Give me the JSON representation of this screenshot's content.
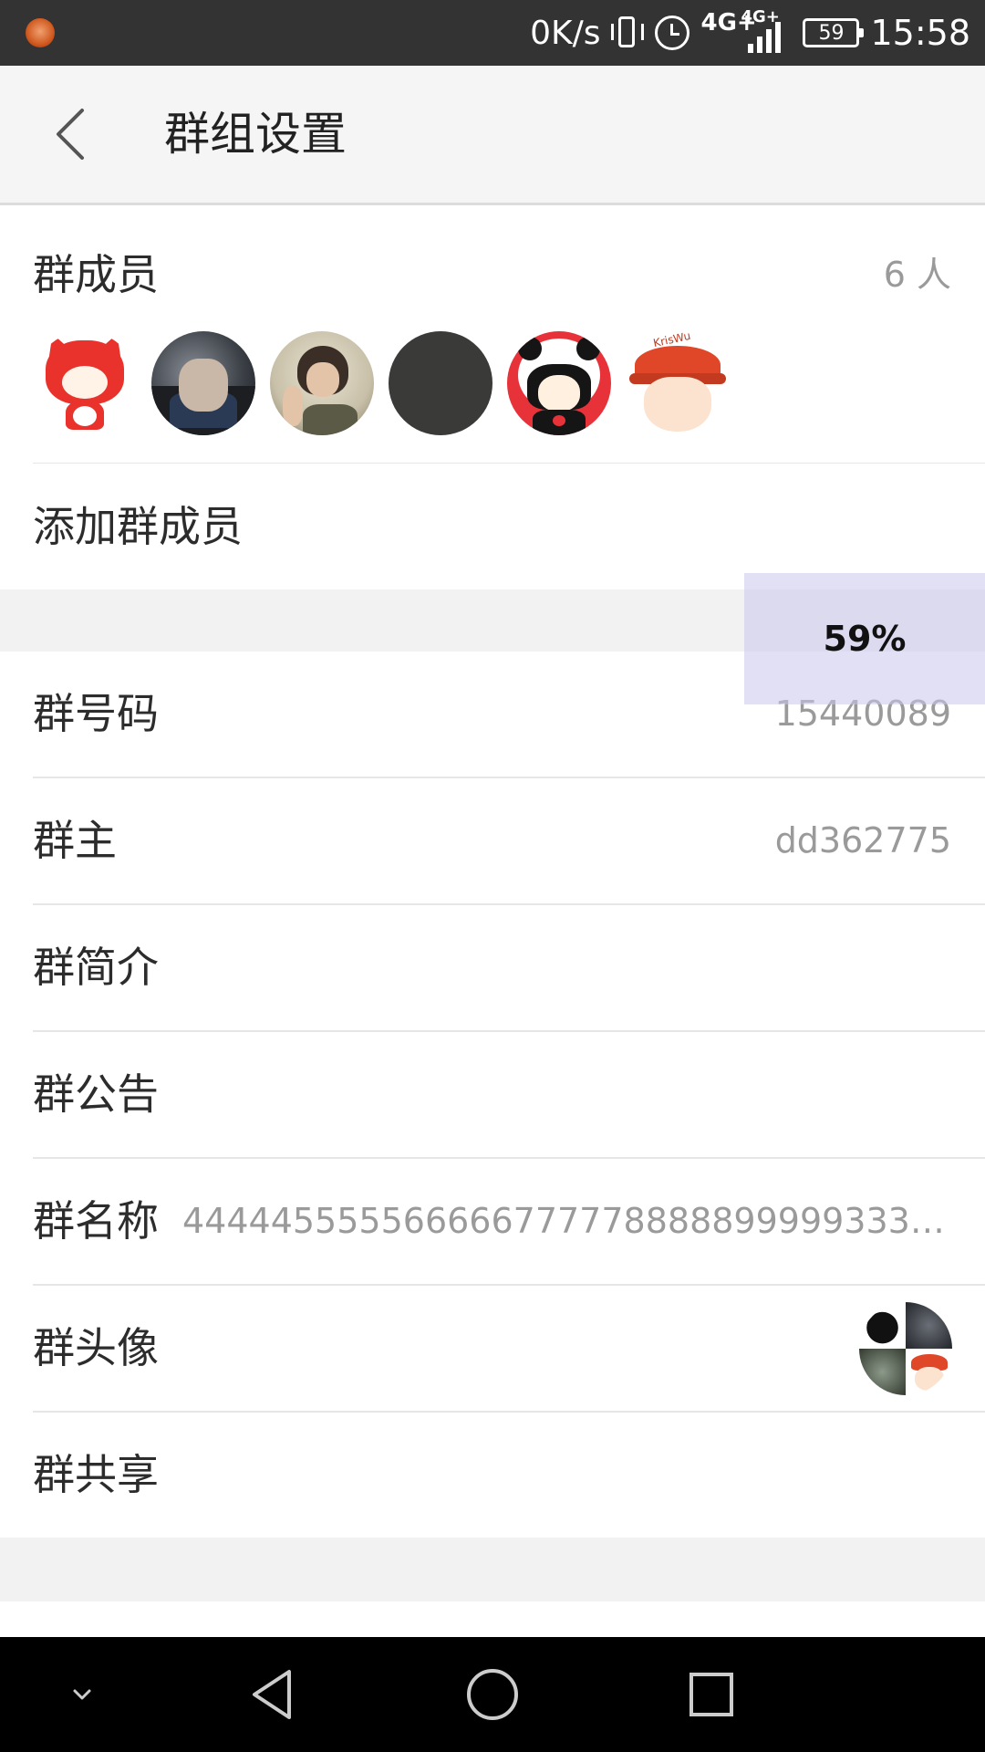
{
  "status_bar": {
    "net_speed": "0K/s",
    "network_primary": "4G+",
    "network_secondary": "4G+",
    "battery_level": "59",
    "time": "15:58"
  },
  "title_bar": {
    "back_icon": "chevron-left-icon",
    "title": "群组设置"
  },
  "members": {
    "label": "群成员",
    "count_text": "6 人",
    "avatars": [
      "cartoon-fox-avatar",
      "man-in-car-photo-avatar",
      "peace-sign-photo-avatar",
      "dark-gray-avatar",
      "panda-hood-girl-avatar",
      "red-cap-boy-avatar"
    ],
    "cap_tag": "KrisWu"
  },
  "add_member": {
    "label": "添加群成员"
  },
  "progress_overlay": {
    "text": "59%"
  },
  "group_number": {
    "label": "群号码",
    "value": "15440089"
  },
  "group_owner": {
    "label": "群主",
    "value": "dd362775"
  },
  "group_intro": {
    "label": "群简介"
  },
  "group_notice": {
    "label": "群公告"
  },
  "group_name": {
    "label": "群名称",
    "value": "4444455555666667777788888999993333…"
  },
  "group_avatar": {
    "label": "群头像"
  },
  "group_share": {
    "label": "群共享"
  },
  "nav_bar": {
    "buttons": [
      "hide-nav-chevron-icon",
      "back-triangle-icon",
      "home-circle-icon",
      "recents-square-icon"
    ]
  },
  "colors": {
    "status_bar_bg": "#333333",
    "title_bar_bg": "#f5f5f5",
    "section_gap_bg": "#f2f2f2",
    "label_text": "#2c2c2c",
    "value_text": "#9a9a9a",
    "nav_bar_bg": "#000000"
  }
}
